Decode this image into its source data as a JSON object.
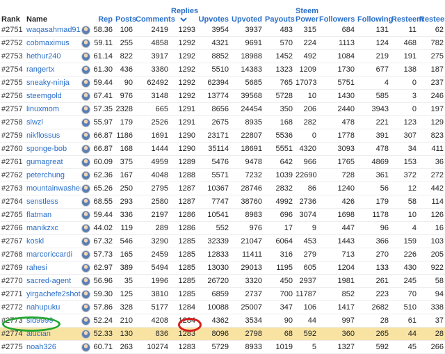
{
  "columns": {
    "rank": "Rank",
    "name": "Name",
    "rep": "Rep",
    "posts": "Posts",
    "comments": "Comments",
    "replies": "Replies",
    "upvotes": "Upvotes",
    "upvoted": "Upvoted",
    "payouts": "Payouts",
    "steem_power_line1": "Steem",
    "steem_power_line2": "Power",
    "followers": "Followers",
    "following": "Following",
    "resteem": "Resteem",
    "resteemed": "Resteemed"
  },
  "highlight_color": "#f8e3a3",
  "rows": [
    {
      "rank": "#2751",
      "name": "waqasahmad911",
      "rep": "58.36",
      "posts": "106",
      "comments": "2419",
      "replies": "1293",
      "upvotes": "3954",
      "upvoted": "3937",
      "payouts": "483",
      "sp": "315",
      "followers": "684",
      "following": "131",
      "resteem": "11",
      "resteemed": "62"
    },
    {
      "rank": "#2752",
      "name": "cobmaximus",
      "rep": "59.11",
      "posts": "255",
      "comments": "4858",
      "replies": "1292",
      "upvotes": "4321",
      "upvoted": "9691",
      "payouts": "570",
      "sp": "224",
      "followers": "1113",
      "following": "124",
      "resteem": "468",
      "resteemed": "782"
    },
    {
      "rank": "#2753",
      "name": "hethur240",
      "rep": "61.14",
      "posts": "822",
      "comments": "3917",
      "replies": "1292",
      "upvotes": "8852",
      "upvoted": "18988",
      "payouts": "1452",
      "sp": "492",
      "followers": "1084",
      "following": "219",
      "resteem": "191",
      "resteemed": "275"
    },
    {
      "rank": "#2754",
      "name": "rangertx",
      "rep": "61.30",
      "posts": "436",
      "comments": "3380",
      "replies": "1292",
      "upvotes": "5510",
      "upvoted": "14383",
      "payouts": "1323",
      "sp": "1209",
      "followers": "1730",
      "following": "677",
      "resteem": "138",
      "resteemed": "187"
    },
    {
      "rank": "#2755",
      "name": "sneaky-ninja",
      "rep": "59.44",
      "posts": "90",
      "comments": "62492",
      "replies": "1292",
      "upvotes": "62394",
      "upvoted": "5685",
      "payouts": "765",
      "sp": "17073",
      "followers": "5751",
      "following": "4",
      "resteem": "0",
      "resteemed": "237"
    },
    {
      "rank": "#2756",
      "name": "steemgold",
      "rep": "67.41",
      "posts": "976",
      "comments": "3148",
      "replies": "1292",
      "upvotes": "13774",
      "upvoted": "39568",
      "payouts": "5728",
      "sp": "10",
      "followers": "1430",
      "following": "585",
      "resteem": "3",
      "resteemed": "246"
    },
    {
      "rank": "#2757",
      "name": "linuxmom",
      "rep": "57.35",
      "posts": "2328",
      "comments": "665",
      "replies": "1291",
      "upvotes": "8656",
      "upvoted": "24454",
      "payouts": "350",
      "sp": "206",
      "followers": "2440",
      "following": "3943",
      "resteem": "0",
      "resteemed": "197"
    },
    {
      "rank": "#2758",
      "name": "slwzl",
      "rep": "55.97",
      "posts": "179",
      "comments": "2526",
      "replies": "1291",
      "upvotes": "2675",
      "upvoted": "8935",
      "payouts": "168",
      "sp": "282",
      "followers": "478",
      "following": "221",
      "resteem": "123",
      "resteemed": "129"
    },
    {
      "rank": "#2759",
      "name": "nikflossus",
      "rep": "66.87",
      "posts": "1186",
      "comments": "1691",
      "replies": "1290",
      "upvotes": "23171",
      "upvoted": "22807",
      "payouts": "5536",
      "sp": "0",
      "followers": "1778",
      "following": "391",
      "resteem": "307",
      "resteemed": "823"
    },
    {
      "rank": "#2760",
      "name": "sponge-bob",
      "rep": "66.87",
      "posts": "168",
      "comments": "1444",
      "replies": "1290",
      "upvotes": "35114",
      "upvoted": "18691",
      "payouts": "5551",
      "sp": "4320",
      "followers": "3093",
      "following": "478",
      "resteem": "34",
      "resteemed": "411"
    },
    {
      "rank": "#2761",
      "name": "gumagreat",
      "rep": "60.09",
      "posts": "375",
      "comments": "4959",
      "replies": "1289",
      "upvotes": "5476",
      "upvoted": "9478",
      "payouts": "642",
      "sp": "966",
      "followers": "1765",
      "following": "4869",
      "resteem": "153",
      "resteemed": "36"
    },
    {
      "rank": "#2762",
      "name": "peterchung",
      "rep": "62.36",
      "posts": "167",
      "comments": "4048",
      "replies": "1288",
      "upvotes": "5571",
      "upvoted": "7232",
      "payouts": "1039",
      "sp": "22690",
      "followers": "728",
      "following": "361",
      "resteem": "372",
      "resteemed": "272"
    },
    {
      "rank": "#2763",
      "name": "mountainwashere",
      "rep": "65.26",
      "posts": "250",
      "comments": "2795",
      "replies": "1287",
      "upvotes": "10367",
      "upvoted": "28746",
      "payouts": "2832",
      "sp": "86",
      "followers": "1240",
      "following": "56",
      "resteem": "12",
      "resteemed": "442"
    },
    {
      "rank": "#2764",
      "name": "senstless",
      "rep": "68.55",
      "posts": "293",
      "comments": "2580",
      "replies": "1287",
      "upvotes": "7747",
      "upvoted": "38760",
      "payouts": "4992",
      "sp": "2736",
      "followers": "426",
      "following": "179",
      "resteem": "58",
      "resteemed": "114"
    },
    {
      "rank": "#2765",
      "name": "flatman",
      "rep": "59.44",
      "posts": "336",
      "comments": "2197",
      "replies": "1286",
      "upvotes": "10541",
      "upvoted": "8983",
      "payouts": "696",
      "sp": "3074",
      "followers": "1698",
      "following": "1178",
      "resteem": "10",
      "resteemed": "126"
    },
    {
      "rank": "#2766",
      "name": "manikzxc",
      "rep": "44.02",
      "posts": "119",
      "comments": "289",
      "replies": "1286",
      "upvotes": "552",
      "upvoted": "976",
      "payouts": "17",
      "sp": "9",
      "followers": "447",
      "following": "96",
      "resteem": "4",
      "resteemed": "16"
    },
    {
      "rank": "#2767",
      "name": "koskl",
      "rep": "67.32",
      "posts": "546",
      "comments": "3290",
      "replies": "1285",
      "upvotes": "32339",
      "upvoted": "21047",
      "payouts": "6064",
      "sp": "453",
      "followers": "1443",
      "following": "366",
      "resteem": "159",
      "resteemed": "103"
    },
    {
      "rank": "#2768",
      "name": "marcoriccardi",
      "rep": "57.73",
      "posts": "165",
      "comments": "2459",
      "replies": "1285",
      "upvotes": "12833",
      "upvoted": "11411",
      "payouts": "316",
      "sp": "279",
      "followers": "713",
      "following": "270",
      "resteem": "226",
      "resteemed": "205"
    },
    {
      "rank": "#2769",
      "name": "rahesi",
      "rep": "62.97",
      "posts": "389",
      "comments": "5494",
      "replies": "1285",
      "upvotes": "13030",
      "upvoted": "29013",
      "payouts": "1195",
      "sp": "605",
      "followers": "1204",
      "following": "133",
      "resteem": "430",
      "resteemed": "922"
    },
    {
      "rank": "#2770",
      "name": "sacred-agent",
      "rep": "56.96",
      "posts": "35",
      "comments": "1996",
      "replies": "1285",
      "upvotes": "26720",
      "upvoted": "3320",
      "payouts": "450",
      "sp": "2937",
      "followers": "1981",
      "following": "261",
      "resteem": "245",
      "resteemed": "58"
    },
    {
      "rank": "#2771",
      "name": "yirgachefe2shot",
      "rep": "59.30",
      "posts": "125",
      "comments": "3810",
      "replies": "1285",
      "upvotes": "6859",
      "upvoted": "2737",
      "payouts": "700",
      "sp": "11787",
      "followers": "852",
      "following": "223",
      "resteem": "70",
      "resteemed": "94"
    },
    {
      "rank": "#2772",
      "name": "nahupuku",
      "rep": "57.86",
      "posts": "328",
      "comments": "5177",
      "replies": "1284",
      "upvotes": "10088",
      "upvoted": "25007",
      "payouts": "347",
      "sp": "106",
      "followers": "1417",
      "following": "2682",
      "resteem": "510",
      "resteemed": "338"
    },
    {
      "rank": "#2773",
      "name": "sid9999",
      "rep": "52.24",
      "posts": "210",
      "comments": "4208",
      "replies": "1284",
      "upvotes": "4362",
      "upvoted": "3534",
      "payouts": "90",
      "sp": "44",
      "followers": "997",
      "following": "28",
      "resteem": "61",
      "resteemed": "37"
    },
    {
      "rank": "#2774",
      "name": "alucian",
      "rep": "52.33",
      "posts": "130",
      "comments": "836",
      "replies": "1283",
      "upvotes": "8096",
      "upvoted": "2798",
      "payouts": "68",
      "sp": "592",
      "followers": "360",
      "following": "265",
      "resteem": "44",
      "resteemed": "28",
      "highlight": true
    },
    {
      "rank": "#2775",
      "name": "noah326",
      "rep": "60.71",
      "posts": "263",
      "comments": "10274",
      "replies": "1283",
      "upvotes": "5729",
      "upvoted": "8933",
      "payouts": "1019",
      "sp": "5",
      "followers": "1327",
      "following": "592",
      "resteem": "45",
      "resteemed": "266"
    }
  ]
}
